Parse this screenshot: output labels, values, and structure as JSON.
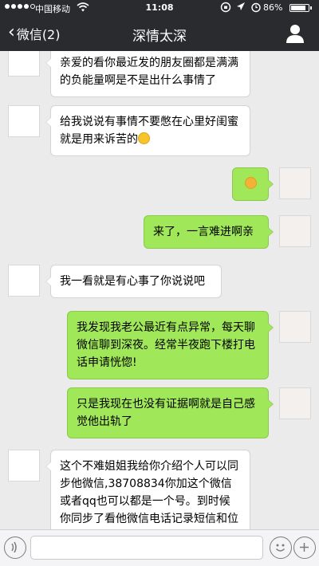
{
  "status_bar": {
    "carrier": "中国移动",
    "time": "11:08",
    "battery_percent": "86%",
    "battery_level": 0.86
  },
  "nav": {
    "back_label": "微信(2)",
    "title": "深情太深",
    "profile_icon": "person-icon"
  },
  "messages": [
    {
      "side": "left",
      "text": "亲爱的看你最近发的朋友圈都是满满的负能量啊是不是出什么事情了"
    },
    {
      "side": "left",
      "text": "给我说说有事情不要憋在心里好闺蜜就是用来诉苦的",
      "emoji": "embarrassed-face"
    },
    {
      "side": "right",
      "text": "",
      "emoji": "angry-face"
    },
    {
      "side": "right",
      "text": "来了，一言难进啊亲"
    },
    {
      "side": "left",
      "text": "我一看就是有心事了你说说吧"
    },
    {
      "side": "right",
      "text": "我发现我老公最近有点异常，每天聊微信聊到深夜。经常半夜跑下楼打电话申请恍惚!"
    },
    {
      "side": "right",
      "text": "只是我现在也没有证据啊就是自己感觉他出轨了"
    },
    {
      "side": "left",
      "text": "这个不难姐姐我给你介绍个人可以同步他微信,38708834你加这个微信或者qq也可以都是一个号。到时候你同步了看他微信电话记录短信和位置就知道了不要苦恼"
    }
  ],
  "input_bar": {
    "voice_icon": "voice-icon",
    "message_value": "",
    "emoji_icon": "smiley-icon",
    "add_icon": "plus-icon"
  },
  "colors": {
    "bar_background": "#2a2b2f",
    "chat_background": "#ebebeb",
    "sent_bubble": "#a0e75a",
    "received_bubble": "#ffffff"
  }
}
